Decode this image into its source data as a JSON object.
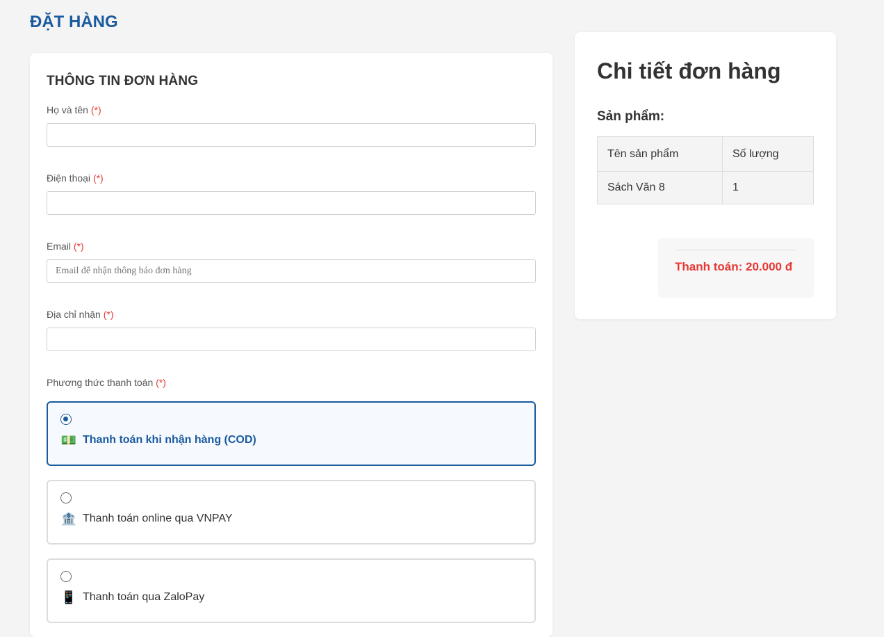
{
  "page": {
    "title": "ĐẶT HÀNG"
  },
  "order_form": {
    "title": "THÔNG TIN ĐƠN HÀNG",
    "required_marker": "(*)",
    "fields": [
      {
        "label": "Họ và tên",
        "value": "",
        "placeholder": ""
      },
      {
        "label": "Điện thoại",
        "value": "",
        "placeholder": ""
      },
      {
        "label": "Email",
        "value": "",
        "placeholder": "Email để nhận thông báo đơn hàng"
      },
      {
        "label": "Địa chỉ nhận",
        "value": "",
        "placeholder": ""
      }
    ],
    "payment": {
      "label": "Phương thức thanh toán",
      "selected": "cod",
      "options": [
        {
          "id": "cod",
          "icon": "money-icon",
          "glyph": "💵",
          "label": "Thanh toán khi nhận hàng (COD)",
          "selected": true
        },
        {
          "id": "vnpay",
          "icon": "bank-icon",
          "glyph": "🏦",
          "label": "Thanh toán online qua VNPAY",
          "selected": false
        },
        {
          "id": "zalopay",
          "icon": "mobile-phone-icon",
          "glyph": "📱",
          "label": "Thanh toán qua ZaloPay",
          "selected": false
        }
      ]
    }
  },
  "order_summary": {
    "title": "Chi tiết đơn hàng",
    "products_heading": "Sản phẩm:",
    "table": {
      "columns": [
        "Tên sản phẩm",
        "Số lượng"
      ],
      "rows": [
        [
          "Sách Văn 8",
          "1"
        ]
      ]
    },
    "total_text": "Thanh toán: 20.000 đ"
  },
  "colors": {
    "primary": "#1a5a9e",
    "required": "#e53935",
    "total": "#e53935",
    "background": "#f4f4f4"
  }
}
